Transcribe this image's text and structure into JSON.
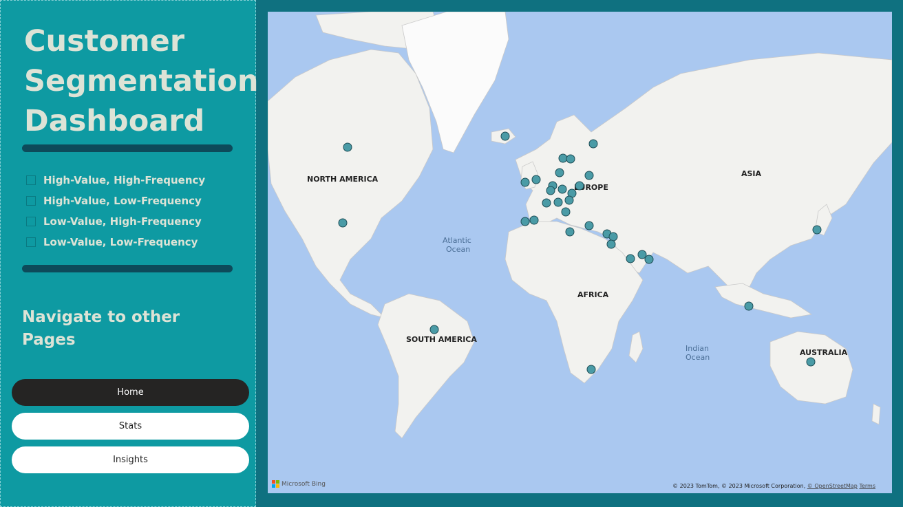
{
  "sidebar": {
    "title_lines": [
      "Customer",
      "Segmentation",
      "Dashboard"
    ],
    "legend": [
      {
        "label": "High-Value, High-Frequency"
      },
      {
        "label": "High-Value, Low-Frequency"
      },
      {
        "label": "Low-Value, High-Frequency"
      },
      {
        "label": "Low-Value, Low-Frequency"
      }
    ],
    "nav_heading": "Navigate to other Pages",
    "nav_buttons": [
      {
        "label": "Home",
        "active": true
      },
      {
        "label": "Stats",
        "active": false
      },
      {
        "label": "Insights",
        "active": false
      }
    ]
  },
  "map": {
    "continent_labels": [
      "NORTH AMERICA",
      "SOUTH AMERICA",
      "EUROPE",
      "AFRICA",
      "ASIA",
      "AUSTRALIA"
    ],
    "ocean_labels": [
      "Atlantic Ocean",
      "Indian Ocean"
    ],
    "provider": "Microsoft Bing",
    "attribution": "© 2023 TomTom, © 2023 Microsoft Corporation,",
    "osm_link": "© OpenStreetMap",
    "terms_link": "Terms",
    "marker_color": "#4a9ba6"
  },
  "colors": {
    "sidebar_bg": "#0e9aa2",
    "page_bg": "#0f7180",
    "divider": "#0d4a5a",
    "title_text": "#dde3d6",
    "active_button": "#252423"
  }
}
